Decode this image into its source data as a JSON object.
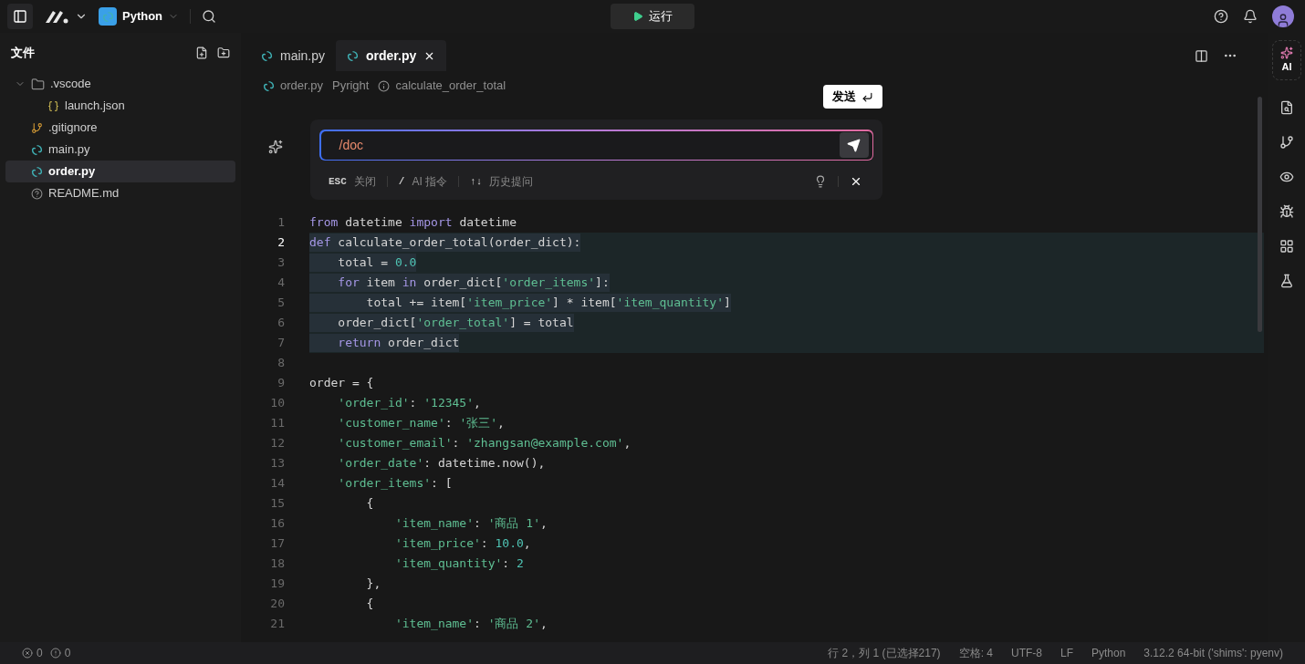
{
  "top_bar": {
    "project": "Python",
    "run_button": "运行"
  },
  "sidebar": {
    "title": "文件",
    "tree": [
      {
        "name": ".vscode",
        "kind": "folder",
        "expanded": true,
        "selected": false,
        "children": [
          {
            "name": "launch.json",
            "kind": "json",
            "selected": false
          }
        ]
      },
      {
        "name": ".gitignore",
        "kind": "git",
        "selected": false
      },
      {
        "name": "main.py",
        "kind": "python",
        "selected": false
      },
      {
        "name": "order.py",
        "kind": "python",
        "selected": true
      },
      {
        "name": "README.md",
        "kind": "readme",
        "selected": false
      }
    ]
  },
  "editor": {
    "tabs": [
      {
        "label": "main.py",
        "selected": false
      },
      {
        "label": "order.py",
        "selected": true
      }
    ],
    "breadcrumbs": [
      {
        "kind": "file",
        "text": "order.py"
      },
      {
        "kind": "text",
        "text": "Pyright"
      },
      {
        "kind": "symbol",
        "text": "calculate_order_total"
      }
    ],
    "ai_prompt": {
      "value": "/doc",
      "tooltip": "发送",
      "hints": [
        {
          "key": "ESC",
          "label": "关闭"
        },
        {
          "key": "/",
          "label": "AI 指令"
        },
        {
          "key": "↑↓",
          "label": "历史提问"
        }
      ]
    },
    "lines": [
      {
        "number": "1",
        "current": false,
        "selected": false,
        "tokens": [
          {
            "kind": "kw",
            "text": "from"
          },
          {
            "kind": "plain",
            "text": " datetime "
          },
          {
            "kind": "kw",
            "text": "import"
          },
          {
            "kind": "plain",
            "text": " datetime"
          }
        ]
      },
      {
        "number": "2",
        "current": true,
        "selected": true,
        "tokens": [
          {
            "kind": "kw",
            "text": "def"
          },
          {
            "kind": "plain",
            "text": " calculate_order_total(order_dict):"
          }
        ]
      },
      {
        "number": "3",
        "current": false,
        "selected": true,
        "tokens": [
          {
            "kind": "plain",
            "text": "    total = "
          },
          {
            "kind": "num",
            "text": "0.0"
          }
        ]
      },
      {
        "number": "4",
        "current": false,
        "selected": true,
        "tokens": [
          {
            "kind": "kw",
            "text": "    for"
          },
          {
            "kind": "plain",
            "text": " item "
          },
          {
            "kind": "kw",
            "text": "in"
          },
          {
            "kind": "plain",
            "text": " order_dict["
          },
          {
            "kind": "str",
            "text": "'order_items'"
          },
          {
            "kind": "plain",
            "text": "]:"
          }
        ]
      },
      {
        "number": "5",
        "current": false,
        "selected": true,
        "tokens": [
          {
            "kind": "plain",
            "text": "        total += item["
          },
          {
            "kind": "str",
            "text": "'item_price'"
          },
          {
            "kind": "plain",
            "text": "] * item["
          },
          {
            "kind": "str",
            "text": "'item_quantity'"
          },
          {
            "kind": "plain",
            "text": "]"
          }
        ]
      },
      {
        "number": "6",
        "current": false,
        "selected": true,
        "tokens": [
          {
            "kind": "plain",
            "text": "    order_dict["
          },
          {
            "kind": "str",
            "text": "'order_total'"
          },
          {
            "kind": "plain",
            "text": "] = total"
          }
        ]
      },
      {
        "number": "7",
        "current": false,
        "selected": true,
        "tokens": [
          {
            "kind": "kw",
            "text": "    return"
          },
          {
            "kind": "plain",
            "text": " order_dict"
          }
        ]
      },
      {
        "number": "8",
        "current": false,
        "selected": false
      },
      {
        "number": "9",
        "current": false,
        "selected": false,
        "tokens": [
          {
            "kind": "plain",
            "text": "order = {"
          }
        ]
      },
      {
        "number": "10",
        "current": false,
        "selected": false,
        "tokens": [
          {
            "kind": "str",
            "text": "    'order_id'"
          },
          {
            "kind": "plain",
            "text": ": "
          },
          {
            "kind": "str",
            "text": "'12345'"
          },
          {
            "kind": "plain",
            "text": ","
          }
        ]
      },
      {
        "number": "11",
        "current": false,
        "selected": false,
        "tokens": [
          {
            "kind": "str",
            "text": "    'customer_name'"
          },
          {
            "kind": "plain",
            "text": ": "
          },
          {
            "kind": "str",
            "text": "'张三'"
          },
          {
            "kind": "plain",
            "text": ","
          }
        ]
      },
      {
        "number": "12",
        "current": false,
        "selected": false,
        "tokens": [
          {
            "kind": "str",
            "text": "    'customer_email'"
          },
          {
            "kind": "plain",
            "text": ": "
          },
          {
            "kind": "str",
            "text": "'zhangsan@example.com'"
          },
          {
            "kind": "plain",
            "text": ","
          }
        ]
      },
      {
        "number": "13",
        "current": false,
        "selected": false,
        "tokens": [
          {
            "kind": "str",
            "text": "    'order_date'"
          },
          {
            "kind": "plain",
            "text": ": datetime.now(),"
          }
        ]
      },
      {
        "number": "14",
        "current": false,
        "selected": false,
        "tokens": [
          {
            "kind": "str",
            "text": "    'order_items'"
          },
          {
            "kind": "plain",
            "text": ": ["
          }
        ]
      },
      {
        "number": "15",
        "current": false,
        "selected": false,
        "tokens": [
          {
            "kind": "plain",
            "text": "        {"
          }
        ]
      },
      {
        "number": "16",
        "current": false,
        "selected": false,
        "tokens": [
          {
            "kind": "str",
            "text": "            'item_name'"
          },
          {
            "kind": "plain",
            "text": ": "
          },
          {
            "kind": "str",
            "text": "'商品 1'"
          },
          {
            "kind": "plain",
            "text": ","
          }
        ]
      },
      {
        "number": "17",
        "current": false,
        "selected": false,
        "tokens": [
          {
            "kind": "str",
            "text": "            'item_price'"
          },
          {
            "kind": "plain",
            "text": ": "
          },
          {
            "kind": "num",
            "text": "10.0"
          },
          {
            "kind": "plain",
            "text": ","
          }
        ]
      },
      {
        "number": "18",
        "current": false,
        "selected": false,
        "tokens": [
          {
            "kind": "str",
            "text": "            'item_quantity'"
          },
          {
            "kind": "plain",
            "text": ": "
          },
          {
            "kind": "num",
            "text": "2"
          }
        ]
      },
      {
        "number": "19",
        "current": false,
        "selected": false,
        "tokens": [
          {
            "kind": "plain",
            "text": "        },"
          }
        ]
      },
      {
        "number": "20",
        "current": false,
        "selected": false,
        "tokens": [
          {
            "kind": "plain",
            "text": "        {"
          }
        ]
      },
      {
        "number": "21",
        "current": false,
        "selected": false,
        "tokens": [
          {
            "kind": "str",
            "text": "            'item_name'"
          },
          {
            "kind": "plain",
            "text": ": "
          },
          {
            "kind": "str",
            "text": "'商品 2'"
          },
          {
            "kind": "plain",
            "text": ","
          }
        ]
      }
    ]
  },
  "activity_bar": {
    "ai_label": "AI"
  },
  "status_bar": {
    "errors": "0",
    "warnings": "0",
    "items": [
      "行 2，列 1 (已选择217)",
      "空格: 4",
      "UTF-8",
      "LF",
      "Python",
      "3.12.2 64-bit ('shims': pyenv)"
    ]
  }
}
